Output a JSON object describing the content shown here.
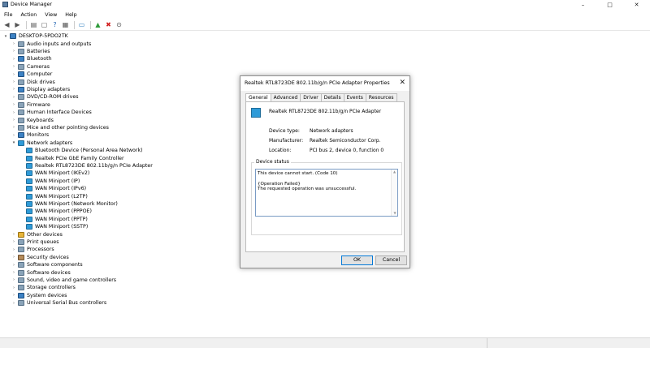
{
  "window": {
    "title": "Device Manager",
    "controls": [
      "–",
      "□",
      "✕"
    ]
  },
  "menu": [
    "File",
    "Action",
    "View",
    "Help"
  ],
  "toolbar": {
    "icons": [
      "back-arrow-icon",
      "forward-arrow-icon",
      "properties-icon",
      "show-hidden-icon",
      "help-icon",
      "details-icon",
      "monitor-icon",
      "update-driver-icon",
      "uninstall-icon",
      "enable-device-icon"
    ]
  },
  "tree": {
    "root": "DESKTOP-5PDO2TK",
    "categories": [
      "Audio inputs and outputs",
      "Batteries",
      "Bluetooth",
      "Cameras",
      "Computer",
      "Disk drives",
      "Display adapters",
      "DVD/CD-ROM drives",
      "Firmware",
      "Human Interface Devices",
      "Keyboards",
      "Mice and other pointing devices",
      "Monitors",
      "Network adapters"
    ],
    "network_children": [
      "Bluetooth Device (Personal Area Network)",
      "Realtek PCIe GbE Family Controller",
      "Realtek RTL8723DE 802.11b/g/n PCIe Adapter",
      "WAN Miniport (IKEv2)",
      "WAN Miniport (IP)",
      "WAN Miniport (IPv6)",
      "WAN Miniport (L2TP)",
      "WAN Miniport (Network Monitor)",
      "WAN Miniport (PPPOE)",
      "WAN Miniport (PPTP)",
      "WAN Miniport (SSTP)"
    ],
    "categories_after": [
      "Other devices",
      "Print queues",
      "Processors",
      "Security devices",
      "Software components",
      "Software devices",
      "Sound, video and game controllers",
      "Storage controllers",
      "System devices",
      "Universal Serial Bus controllers"
    ]
  },
  "dialog": {
    "title": "Realtek RTL8723DE 802.11b/g/n PCIe Adapter Properties",
    "close": "✕",
    "tabs": [
      "General",
      "Advanced",
      "Driver",
      "Details",
      "Events",
      "Resources"
    ],
    "device_name": "Realtek RTL8723DE 802.11b/g/n PCIe Adapter",
    "device_type_label": "Device type:",
    "device_type": "Network adapters",
    "manufacturer_label": "Manufacturer:",
    "manufacturer": "Realtek Semiconductor Corp.",
    "location_label": "Location:",
    "location": "PCI bus 2, device 0, function 0",
    "status_group": "Device status",
    "status_line1": "This device cannot start. (Code 10)",
    "status_line2": "{Operation Failed}",
    "status_line3": "The requested operation was unsuccessful.",
    "ok": "OK",
    "cancel": "Cancel"
  }
}
